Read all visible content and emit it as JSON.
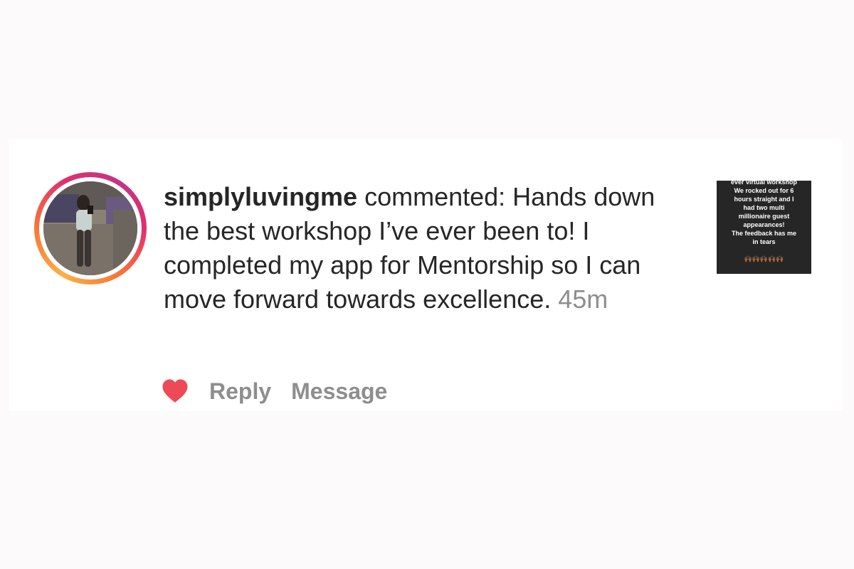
{
  "comment": {
    "username": "simplyluvingme",
    "verb": " commented: ",
    "text": "Hands down the best workshop I’ve ever been to! I completed my app for Mentorship so I can move forward towards excellence.",
    "timestamp": "45m"
  },
  "actions": {
    "like_icon": "heart-icon",
    "like_color": "#ed4956",
    "reply_label": "Reply",
    "message_label": "Message"
  },
  "post_thumbnail": {
    "lines": [
      "ever virtual workshop",
      "We rocked out for 6",
      "hours straight and I",
      "had two multi",
      "millionaire guest",
      "appearances!",
      "The feedback has me",
      "in tears"
    ],
    "emoji": "🙌🏾🙌🏾🙌🏾🙌🏾🙌🏾"
  },
  "colors": {
    "background": "#fcfafb",
    "card": "#ffffff",
    "text": "#262626",
    "muted": "#8e8e8e",
    "heart": "#ed4956"
  }
}
